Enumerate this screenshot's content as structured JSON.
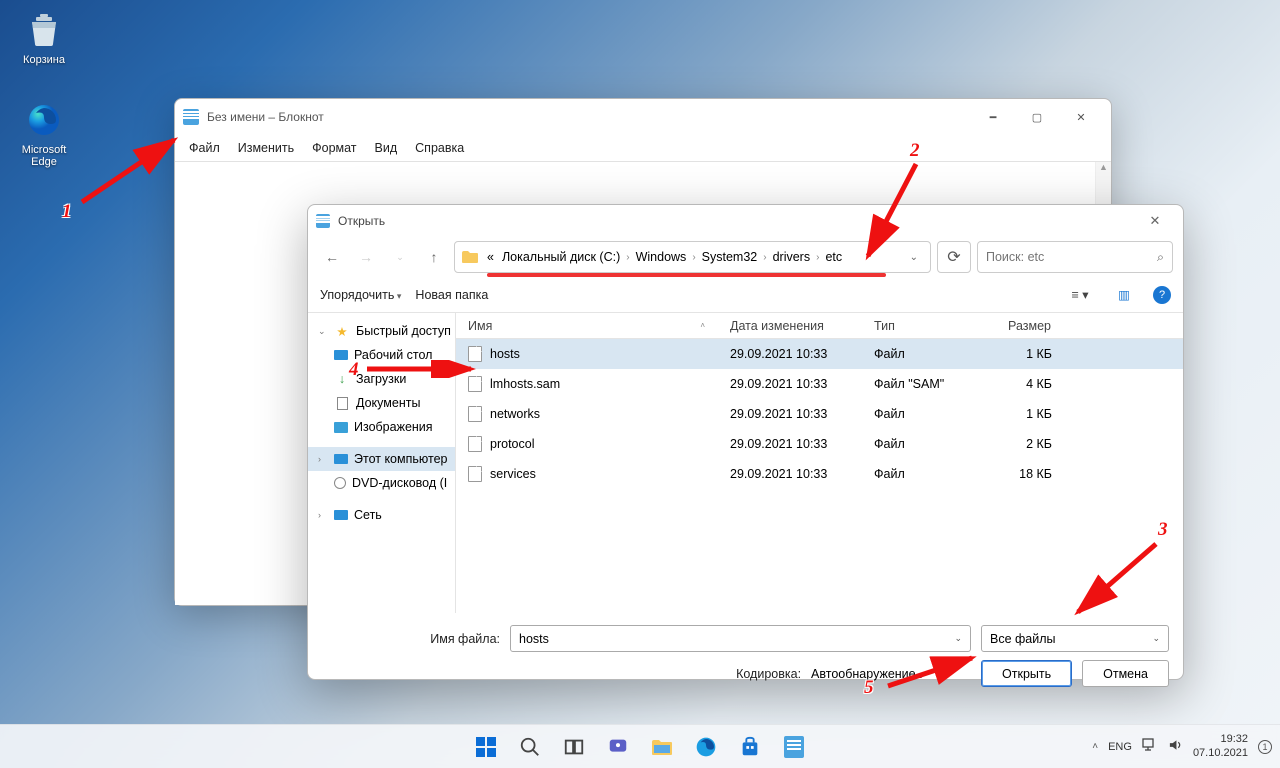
{
  "desktop": {
    "recycle_bin": "Корзина",
    "edge": "Microsoft Edge"
  },
  "notepad": {
    "title": "Без имени – Блокнот",
    "menu": {
      "file": "Файл",
      "edit": "Изменить",
      "format": "Формат",
      "view": "Вид",
      "help": "Справка"
    }
  },
  "dialog": {
    "title": "Открыть",
    "breadcrumb": {
      "pre": "«",
      "c": "Локальный диск (C:)",
      "w": "Windows",
      "s": "System32",
      "d": "drivers",
      "e": "etc"
    },
    "search_placeholder": "Поиск: etc",
    "organize": "Упорядочить",
    "new_folder": "Новая папка",
    "sidebar": {
      "quick": "Быстрый доступ",
      "desktop": "Рабочий стол",
      "downloads": "Загрузки",
      "documents": "Документы",
      "pictures": "Изображения",
      "this_pc": "Этот компьютер",
      "dvd": "DVD-дисковод (I",
      "network": "Сеть"
    },
    "columns": {
      "name": "Имя",
      "date": "Дата изменения",
      "type": "Тип",
      "size": "Размер"
    },
    "files": [
      {
        "name": "hosts",
        "date": "29.09.2021 10:33",
        "type": "Файл",
        "size": "1 КБ",
        "sel": true
      },
      {
        "name": "lmhosts.sam",
        "date": "29.09.2021 10:33",
        "type": "Файл \"SAM\"",
        "size": "4 КБ",
        "sel": false
      },
      {
        "name": "networks",
        "date": "29.09.2021 10:33",
        "type": "Файл",
        "size": "1 КБ",
        "sel": false
      },
      {
        "name": "protocol",
        "date": "29.09.2021 10:33",
        "type": "Файл",
        "size": "2 КБ",
        "sel": false
      },
      {
        "name": "services",
        "date": "29.09.2021 10:33",
        "type": "Файл",
        "size": "18 КБ",
        "sel": false
      }
    ],
    "filename_label": "Имя файла:",
    "filename_value": "hosts",
    "filetype_value": "Все файлы",
    "encoding_label": "Кодировка:",
    "encoding_value": "Автообнаружение",
    "open_btn": "Открыть",
    "cancel_btn": "Отмена"
  },
  "taskbar": {
    "lang": "ENG",
    "time": "19:32",
    "date": "07.10.2021"
  },
  "annotations": {
    "n1": "1",
    "n2": "2",
    "n3": "3",
    "n4": "4",
    "n5": "5"
  }
}
